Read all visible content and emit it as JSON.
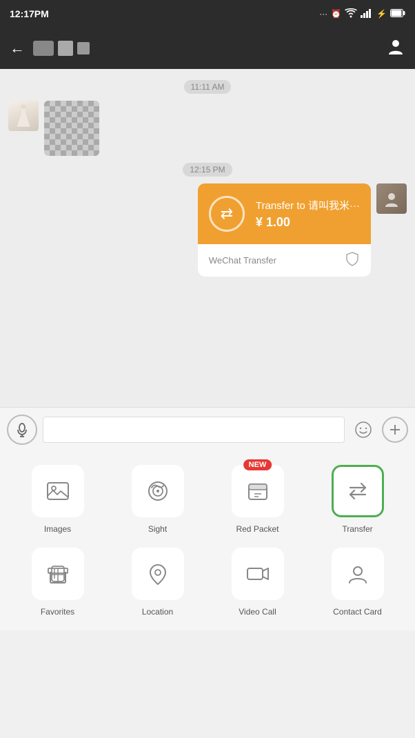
{
  "statusBar": {
    "time": "12:17PM",
    "icons": "··· ⏰ WiFi Signal ⚡ 🔋"
  },
  "header": {
    "backLabel": "←",
    "userIconLabel": "👤"
  },
  "chat": {
    "timestamp1": "11:11 AM",
    "timestamp2": "12:15 PM",
    "transferTitle": "Transfer to 请叫我米···",
    "transferAmount": "¥ 1.00",
    "transferFooter": "WeChat Transfer"
  },
  "inputArea": {
    "placeholder": "",
    "voiceLabel": "🔊",
    "emojiLabel": "😊",
    "addLabel": "+"
  },
  "bottomPanel": {
    "items": [
      {
        "label": "Images",
        "icon": "image",
        "badge": null,
        "highlighted": false
      },
      {
        "label": "Sight",
        "icon": "sight",
        "badge": null,
        "highlighted": false
      },
      {
        "label": "Red Packet",
        "icon": "redpacket",
        "badge": "NEW",
        "highlighted": false
      },
      {
        "label": "Transfer",
        "icon": "transfer",
        "badge": null,
        "highlighted": true
      },
      {
        "label": "Favorites",
        "icon": "favorites",
        "badge": null,
        "highlighted": false
      },
      {
        "label": "Location",
        "icon": "location",
        "badge": null,
        "highlighted": false
      },
      {
        "label": "Video Call",
        "icon": "videocall",
        "badge": null,
        "highlighted": false
      },
      {
        "label": "Contact Card",
        "icon": "contactcard",
        "badge": null,
        "highlighted": false
      }
    ]
  }
}
